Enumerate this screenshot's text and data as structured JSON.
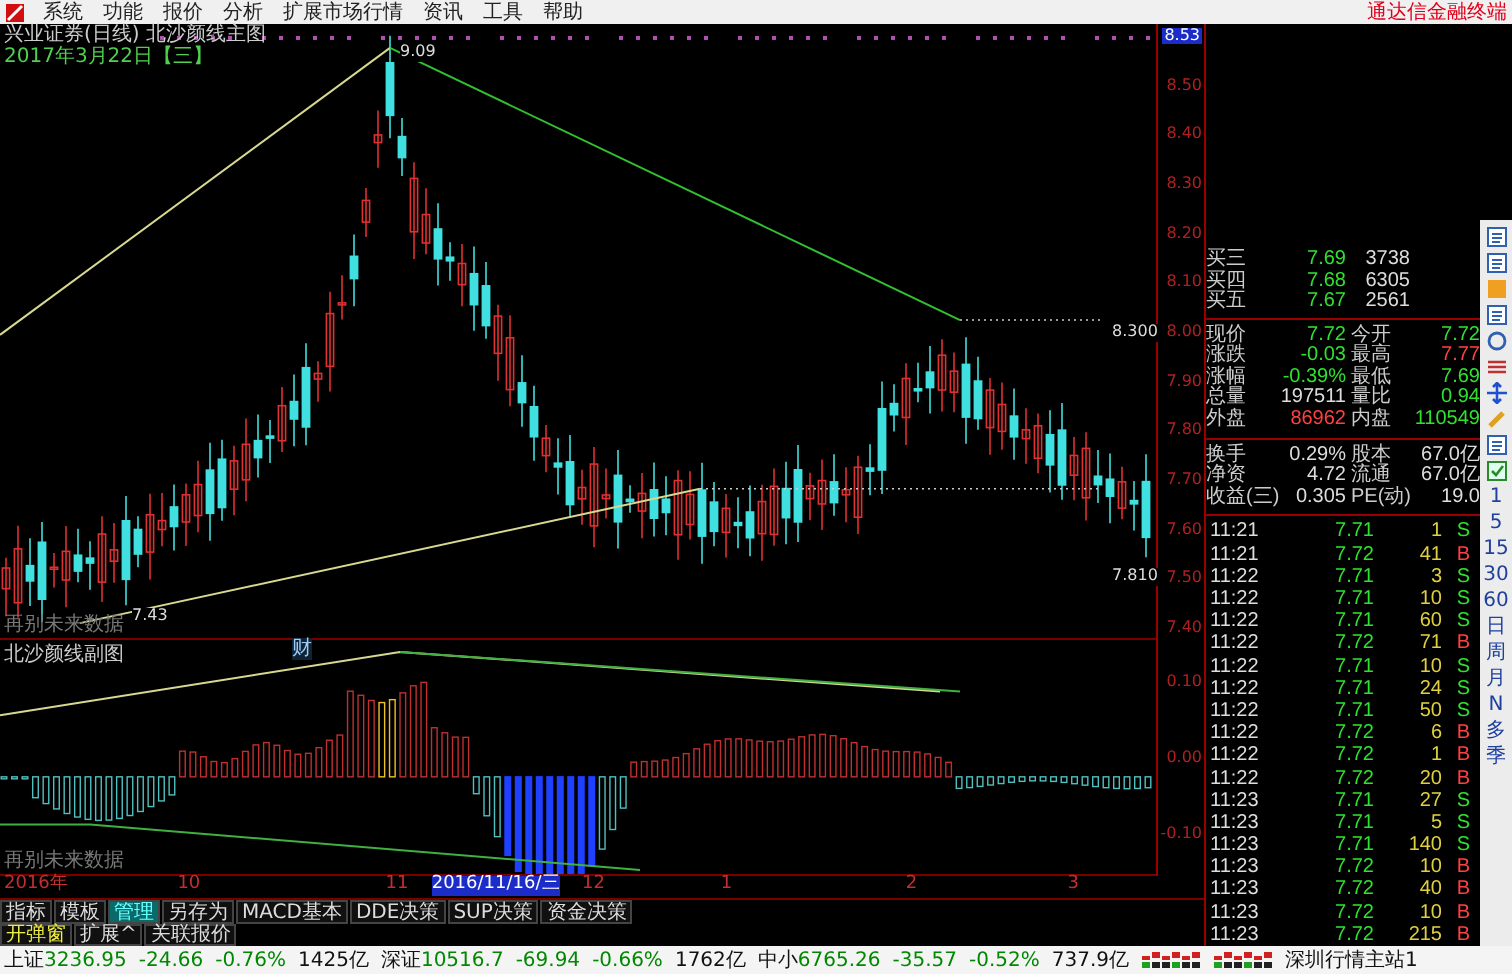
{
  "menu_bar": {
    "items": [
      "系统",
      "功能",
      "报价",
      "分析",
      "扩展市场行情",
      "资讯",
      "工具",
      "帮助"
    ],
    "brand": "通达信金融终端"
  },
  "price_chart": {
    "title": "兴业证券(日线) 北沙颜线主图",
    "date": "2017年3月22日【三】",
    "annotations": [
      {
        "kind": "high",
        "text": "9.09"
      },
      {
        "kind": "resistance",
        "text": "8.300"
      },
      {
        "kind": "support",
        "text": "7.810"
      },
      {
        "kind": "low",
        "text": "7.43"
      }
    ],
    "note": "再别未来数据",
    "finance_marker": "财",
    "axis": [
      {
        "text": "8.53",
        "selected": true
      },
      {
        "text": "8.50",
        "selected": false
      },
      {
        "text": "8.40",
        "selected": false
      },
      {
        "text": "8.30",
        "selected": false
      },
      {
        "text": "8.20",
        "selected": false
      },
      {
        "text": "8.10",
        "selected": false
      },
      {
        "text": "8.00",
        "selected": false
      },
      {
        "text": "7.90",
        "selected": false
      },
      {
        "text": "7.80",
        "selected": false
      },
      {
        "text": "7.70",
        "selected": false
      },
      {
        "text": "7.60",
        "selected": false
      },
      {
        "text": "7.50",
        "selected": false
      },
      {
        "text": "7.40",
        "selected": false
      }
    ]
  },
  "indicator_chart": {
    "title": "北沙颜线副图",
    "note": "再别未来数据",
    "axis": [
      "0.10",
      "0.00",
      "-0.10"
    ]
  },
  "date_axis": [
    {
      "text": "2016年",
      "selected": false
    },
    {
      "text": "10",
      "selected": false
    },
    {
      "text": "11",
      "selected": false
    },
    {
      "text": "2016/11/16/三",
      "selected": true
    },
    {
      "text": "12",
      "selected": false
    },
    {
      "text": "1",
      "selected": false
    },
    {
      "text": "2",
      "selected": false
    },
    {
      "text": "3",
      "selected": false
    }
  ],
  "tabs": [
    {
      "label": "指标",
      "selected": false
    },
    {
      "label": "模板",
      "selected": false
    },
    {
      "label": "管理",
      "selected": true
    },
    {
      "label": "另存为",
      "selected": false
    },
    {
      "label": "MACD基本",
      "selected": false
    },
    {
      "label": "DDE决策",
      "selected": false
    },
    {
      "label": "SUP决策",
      "selected": false
    },
    {
      "label": "资金决策",
      "selected": false
    }
  ],
  "tabs_row_2": [
    {
      "label": "开弹窗",
      "selected": true
    },
    {
      "label": "扩展^",
      "selected": false
    },
    {
      "label": "关联报价",
      "selected": false
    }
  ],
  "quote": {
    "bids": [
      {
        "label": "买三",
        "price": "7.69",
        "volume": "3738"
      },
      {
        "label": "买四",
        "price": "7.68",
        "volume": "6305"
      },
      {
        "label": "买五",
        "price": "7.67",
        "volume": "2561"
      }
    ],
    "stats": [
      {
        "items": [
          {
            "label": "现价",
            "value": "7.72",
            "color": "#30e030"
          },
          {
            "label": "今开",
            "value": "7.72",
            "color": "#30e030"
          }
        ]
      },
      {
        "items": [
          {
            "label": "涨跌",
            "value": "-0.03",
            "color": "#30e030"
          },
          {
            "label": "最高",
            "value": "7.77",
            "color": "#ff4040"
          }
        ]
      },
      {
        "items": [
          {
            "label": "涨幅",
            "value": "-0.39%",
            "color": "#30e030"
          },
          {
            "label": "最低",
            "value": "7.69",
            "color": "#30e030"
          }
        ]
      },
      {
        "items": [
          {
            "label": "总量",
            "value": "197511",
            "color": "#dddddd"
          },
          {
            "label": "量比",
            "value": "0.94",
            "color": "#30e030"
          }
        ]
      },
      {
        "items": [
          {
            "label": "外盘",
            "value": "86962",
            "color": "#ff4040"
          },
          {
            "label": "内盘",
            "value": "110549",
            "color": "#30e030"
          }
        ]
      },
      {
        "items": [
          {
            "label": "换手",
            "value": "0.29%",
            "color": "#dddddd"
          },
          {
            "label": "股本",
            "value": "67.0亿",
            "color": "#dddddd"
          }
        ]
      },
      {
        "items": [
          {
            "label": "净资",
            "value": "4.72",
            "color": "#dddddd"
          },
          {
            "label": "流通",
            "value": "67.0亿",
            "color": "#dddddd"
          }
        ]
      },
      {
        "items": [
          {
            "label": "收益(三)",
            "value": "0.305",
            "color": "#dddddd"
          },
          {
            "label": "PE(动)",
            "value": "19.0",
            "color": "#dddddd"
          }
        ]
      }
    ]
  },
  "trades": [
    {
      "time": "11:21",
      "price": "7.71",
      "volume": "1",
      "side": "S",
      "kind": "sell"
    },
    {
      "time": "11:21",
      "price": "7.72",
      "volume": "41",
      "side": "B",
      "kind": "buy"
    },
    {
      "time": "11:22",
      "price": "7.71",
      "volume": "3",
      "side": "S",
      "kind": "sell"
    },
    {
      "time": "11:22",
      "price": "7.71",
      "volume": "10",
      "side": "S",
      "kind": "sell"
    },
    {
      "time": "11:22",
      "price": "7.71",
      "volume": "60",
      "side": "S",
      "kind": "sell"
    },
    {
      "time": "11:22",
      "price": "7.72",
      "volume": "71",
      "side": "B",
      "kind": "buy"
    },
    {
      "time": "11:22",
      "price": "7.71",
      "volume": "10",
      "side": "S",
      "kind": "sell"
    },
    {
      "time": "11:22",
      "price": "7.71",
      "volume": "24",
      "side": "S",
      "kind": "sell"
    },
    {
      "time": "11:22",
      "price": "7.71",
      "volume": "50",
      "side": "S",
      "kind": "sell"
    },
    {
      "time": "11:22",
      "price": "7.72",
      "volume": "6",
      "side": "B",
      "kind": "buy"
    },
    {
      "time": "11:22",
      "price": "7.72",
      "volume": "1",
      "side": "B",
      "kind": "buy"
    },
    {
      "time": "11:22",
      "price": "7.72",
      "volume": "20",
      "side": "B",
      "kind": "buy"
    },
    {
      "time": "11:23",
      "price": "7.71",
      "volume": "27",
      "side": "S",
      "kind": "sell"
    },
    {
      "time": "11:23",
      "price": "7.71",
      "volume": "5",
      "side": "S",
      "kind": "sell"
    },
    {
      "time": "11:23",
      "price": "7.71",
      "volume": "140",
      "side": "S",
      "kind": "sell"
    },
    {
      "time": "11:23",
      "price": "7.72",
      "volume": "10",
      "side": "B",
      "kind": "buy"
    },
    {
      "time": "11:23",
      "price": "7.72",
      "volume": "40",
      "side": "B",
      "kind": "buy"
    },
    {
      "time": "11:23",
      "price": "7.72",
      "volume": "10",
      "side": "B",
      "kind": "buy"
    },
    {
      "time": "11:23",
      "price": "7.72",
      "volume": "215",
      "side": "B",
      "kind": "buy"
    }
  ],
  "period_toolbar": [
    "1",
    "5",
    "15",
    "30",
    "60",
    "日",
    "周",
    "月",
    "N",
    "多",
    "季"
  ],
  "status_bar": {
    "indices": [
      {
        "name": "上证",
        "value": "3236.95",
        "change": "-24.66",
        "percent": "-0.76%",
        "amount": "1425亿"
      },
      {
        "name": "深证",
        "value": "10516.7",
        "change": "-69.94",
        "percent": "-0.66%",
        "amount": "1762亿"
      },
      {
        "name": "中小",
        "value": "6765.26",
        "change": "-35.57",
        "percent": "-0.52%",
        "amount": "737.9亿"
      }
    ],
    "server": "深圳行情主站1"
  }
}
